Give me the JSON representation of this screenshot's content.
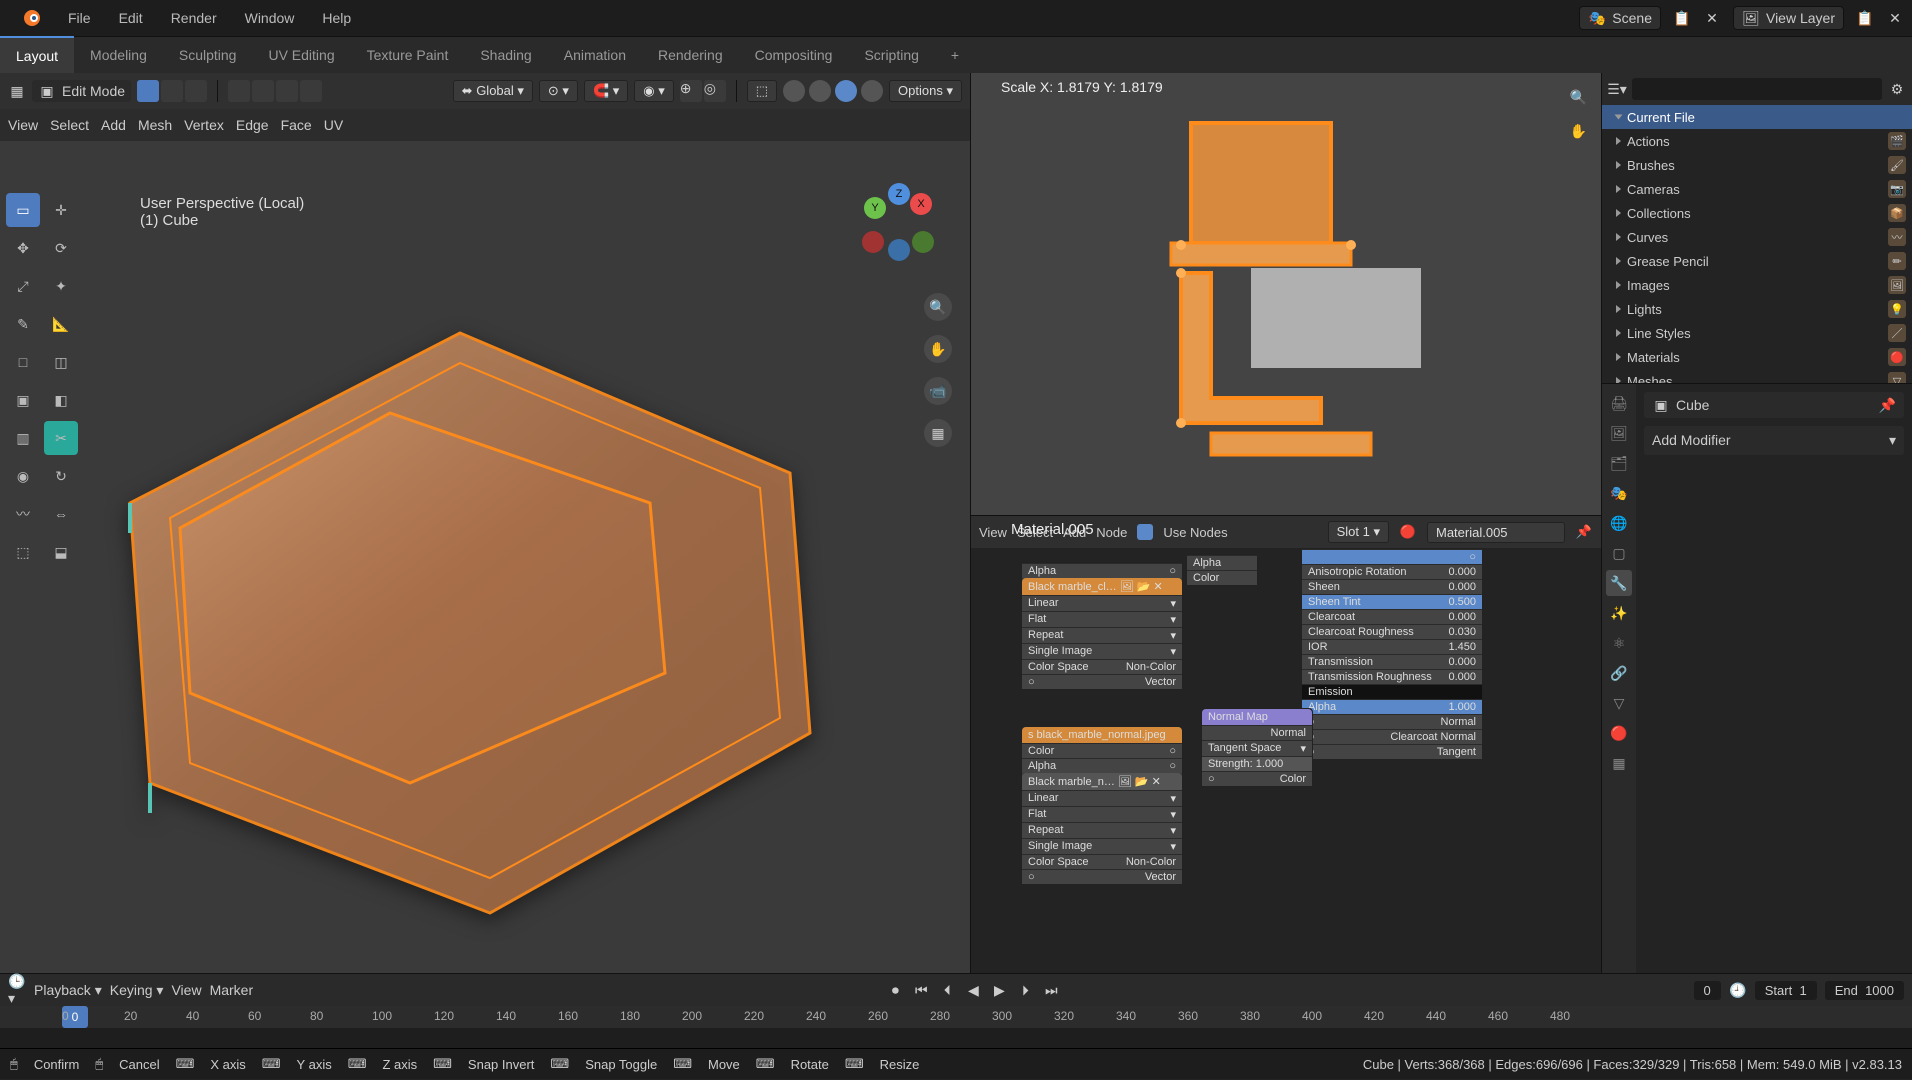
{
  "menus": {
    "file": "File",
    "edit": "Edit",
    "render": "Render",
    "window": "Window",
    "help": "Help"
  },
  "tabs": [
    "Layout",
    "Modeling",
    "Sculpting",
    "UV Editing",
    "Texture Paint",
    "Shading",
    "Animation",
    "Rendering",
    "Compositing",
    "Scripting",
    "+"
  ],
  "active_tab": 0,
  "scene": {
    "label": "Scene"
  },
  "view_layer": {
    "label": "View Layer"
  },
  "header2": {
    "mode": "Edit Mode",
    "orientation": "Global",
    "options": "Options",
    "view": "View",
    "select": "Select",
    "add": "Add",
    "mesh": "Mesh",
    "vertex": "Vertex",
    "edge": "Edge",
    "face": "Face",
    "uv": "UV"
  },
  "viewport": {
    "projection": "User Perspective (Local)",
    "object": "(1)  Cube",
    "axes": {
      "x": "X",
      "y": "Y",
      "z": "Z"
    }
  },
  "viewport2": {
    "scale_label": "Scale X: 1.8179    Y: 1.8179"
  },
  "outliner": {
    "root": "Current File",
    "items": [
      {
        "label": "Actions",
        "ico": "🎬"
      },
      {
        "label": "Brushes",
        "ico": "🖌"
      },
      {
        "label": "Cameras",
        "ico": "📷"
      },
      {
        "label": "Collections",
        "ico": "📦"
      },
      {
        "label": "Curves",
        "ico": "〰"
      },
      {
        "label": "Grease Pencil",
        "ico": "✏"
      },
      {
        "label": "Images",
        "ico": "🖼"
      },
      {
        "label": "Lights",
        "ico": "💡"
      },
      {
        "label": "Line Styles",
        "ico": "／"
      },
      {
        "label": "Materials",
        "ico": "🔴"
      },
      {
        "label": "Meshes",
        "ico": "▽"
      }
    ]
  },
  "properties": {
    "object": "Cube",
    "add_modifier": "Add Modifier"
  },
  "shader": {
    "menus": {
      "view": "View",
      "select": "Select",
      "add": "Add",
      "node": "Node"
    },
    "use_nodes": "Use Nodes",
    "slot": "Slot 1",
    "material": "Material.005",
    "material_label": "Material.005",
    "nodes": {
      "img1": {
        "title": "Black marble_cl…",
        "fields": [
          "Color",
          "Alpha",
          "Linear",
          "Flat",
          "Repeat",
          "Single Image"
        ],
        "colorspace": "Color Space",
        "colorspace_val": "Non-Color",
        "vector": "Vector"
      },
      "img2": {
        "title": "Black marble_n…",
        "fields": [
          "Color",
          "Alpha",
          "Linear",
          "Flat",
          "Repeat",
          "Single Image"
        ],
        "colorspace": "Color Space",
        "colorspace_val": "Non-Color",
        "vector": "Vector",
        "file": "s black_marble_normal.jpeg"
      },
      "normal": {
        "title": "Normal Map",
        "out": "Normal",
        "space": "Tangent Space",
        "strength": "Strength:  1.000",
        "color": "Color"
      },
      "princ": {
        "fields": [
          {
            "l": "Alpha",
            "v": ""
          },
          {
            "l": "Color",
            "v": ""
          },
          {
            "l": "Anisotropic Rotation",
            "v": "0.000"
          },
          {
            "l": "Sheen",
            "v": "0.000"
          },
          {
            "l": "Sheen Tint",
            "v": "0.500",
            "hl": true
          },
          {
            "l": "Clearcoat",
            "v": "0.000"
          },
          {
            "l": "Clearcoat Roughness",
            "v": "0.030"
          },
          {
            "l": "IOR",
            "v": "1.450"
          },
          {
            "l": "Transmission",
            "v": "0.000"
          },
          {
            "l": "Transmission Roughness",
            "v": "0.000"
          },
          {
            "l": "Emission",
            "v": ""
          },
          {
            "l": "Alpha",
            "v": "1.000",
            "hl": true
          },
          {
            "l": "Normal",
            "v": ""
          },
          {
            "l": "Clearcoat Normal",
            "v": ""
          },
          {
            "l": "Tangent",
            "v": ""
          }
        ]
      }
    }
  },
  "timeline": {
    "playback": "Playback",
    "keying": "Keying",
    "view": "View",
    "marker": "Marker",
    "current": 0,
    "start_lbl": "Start",
    "start": 1,
    "end_lbl": "End",
    "end": 1000,
    "ticks": [
      0,
      20,
      40,
      60,
      80,
      100,
      120,
      140,
      160,
      180,
      200,
      220,
      240,
      260,
      280,
      300,
      320,
      340,
      360,
      380,
      400,
      420,
      440,
      460,
      480
    ]
  },
  "statusbar": {
    "confirm": "Confirm",
    "cancel": "Cancel",
    "xaxis": "X axis",
    "yaxis": "Y axis",
    "zaxis": "Z axis",
    "snap_invert": "Snap Invert",
    "snap_toggle": "Snap Toggle",
    "move": "Move",
    "rotate": "Rotate",
    "resize": "Resize",
    "stats": "Cube  |  Verts:368/368  |  Edges:696/696  |  Faces:329/329  |  Tris:658  |  Mem: 549.0 MiB  |  v2.83.13"
  }
}
